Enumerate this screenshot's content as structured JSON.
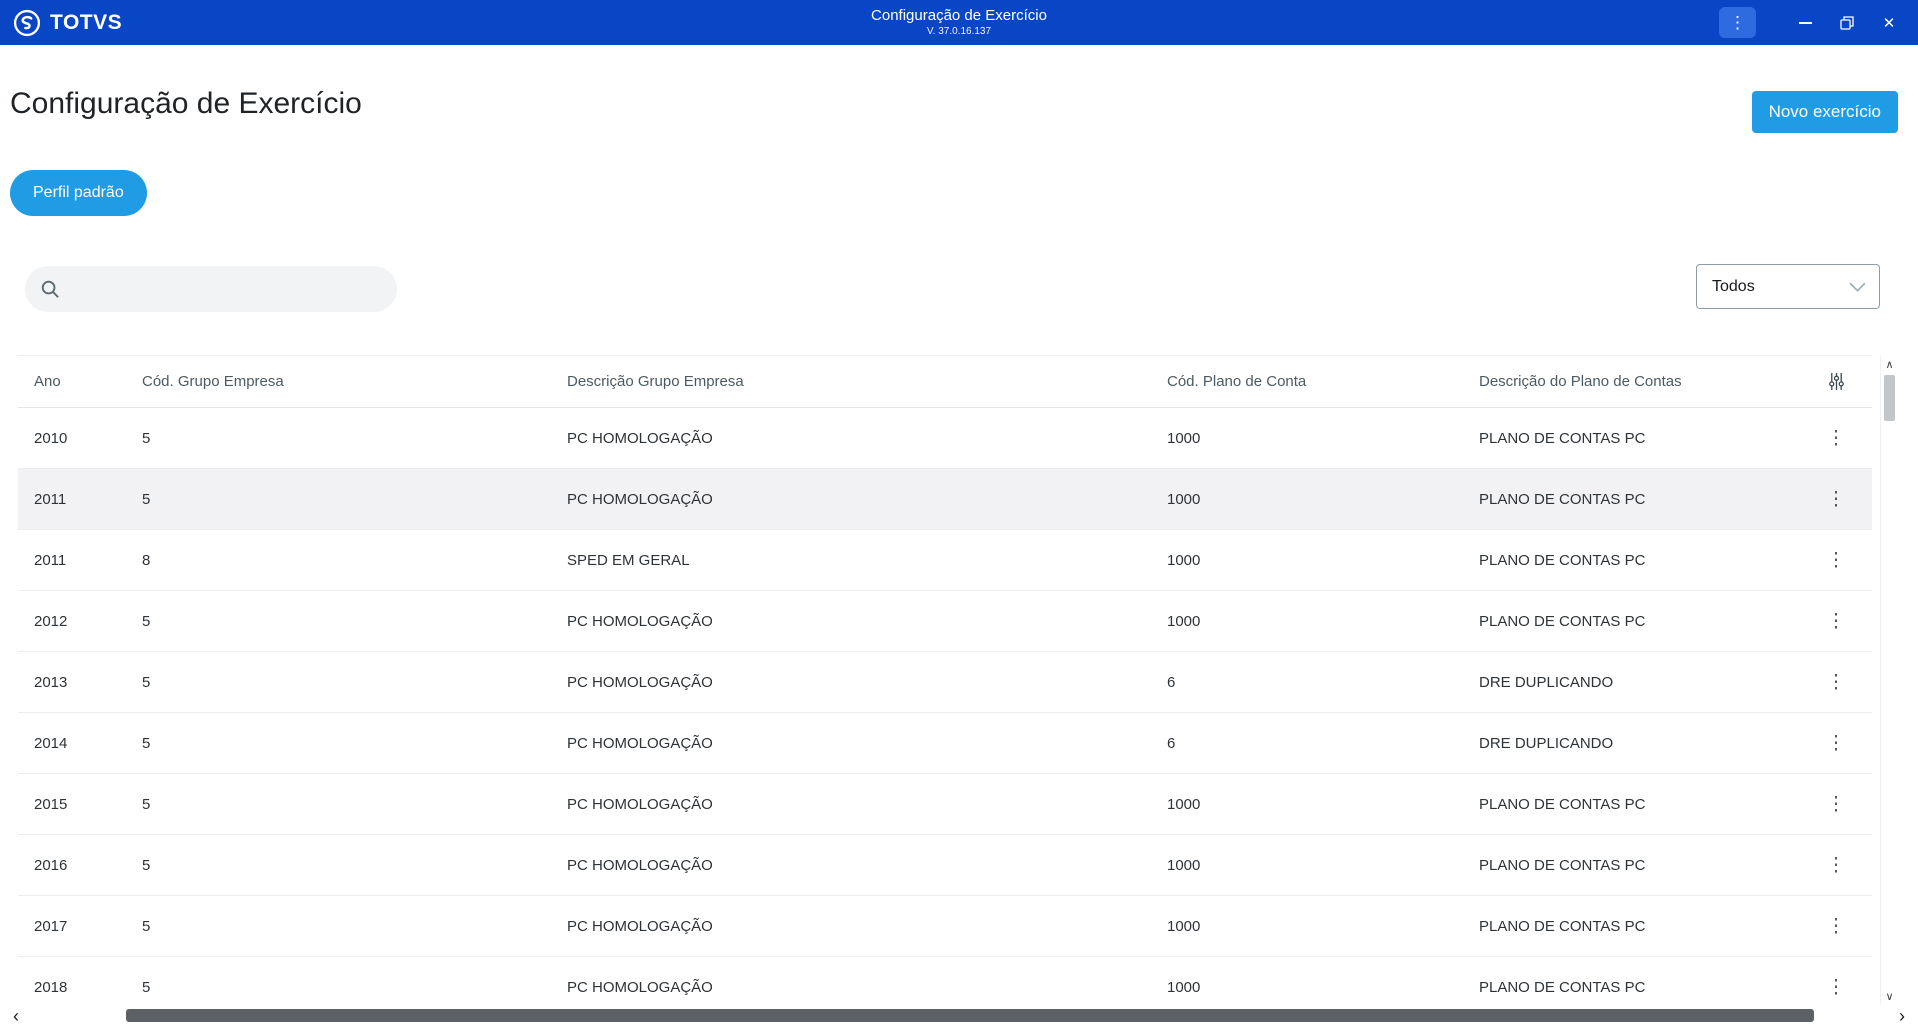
{
  "colors": {
    "titlebar_bg": "#0846C5",
    "accent": "#1F9CE3",
    "accent_dark": "#2F6BE0",
    "selected_row_bg": "#F2F2F4",
    "border": "#E6E8EA",
    "text": "#2E3338",
    "muted": "#4C5B63"
  },
  "titlebar": {
    "brand": "TOTVS",
    "title": "Configuração de Exercício",
    "version": "V. 37.0.16.137",
    "menu_icon": "⋮",
    "close_icon": "✕"
  },
  "page": {
    "title": "Configuração de Exercício",
    "new_exercise_button": "Novo exercício",
    "profile_chip": "Perfil padrão"
  },
  "toolbar": {
    "search_placeholder": "",
    "filter_dropdown_value": "Todos"
  },
  "table": {
    "columns": [
      "Ano",
      "Cód. Grupo Empresa",
      "Descrição Grupo Empresa",
      "Cód. Plano de Conta",
      "Descrição do Plano de Contas"
    ],
    "selected_row_index": 1,
    "row_menu_icon": "⋮",
    "rows": [
      [
        "2010",
        "5",
        "PC HOMOLOGAÇÃO",
        "1000",
        "PLANO DE CONTAS PC"
      ],
      [
        "2011",
        "5",
        "PC HOMOLOGAÇÃO",
        "1000",
        "PLANO DE CONTAS PC"
      ],
      [
        "2011",
        "8",
        "SPED EM GERAL",
        "1000",
        "PLANO DE CONTAS PC"
      ],
      [
        "2012",
        "5",
        "PC HOMOLOGAÇÃO",
        "1000",
        "PLANO DE CONTAS PC"
      ],
      [
        "2013",
        "5",
        "PC HOMOLOGAÇÃO",
        "6",
        "DRE DUPLICANDO"
      ],
      [
        "2014",
        "5",
        "PC HOMOLOGAÇÃO",
        "6",
        "DRE DUPLICANDO"
      ],
      [
        "2015",
        "5",
        "PC HOMOLOGAÇÃO",
        "1000",
        "PLANO DE CONTAS PC"
      ],
      [
        "2016",
        "5",
        "PC HOMOLOGAÇÃO",
        "1000",
        "PLANO DE CONTAS PC"
      ],
      [
        "2017",
        "5",
        "PC HOMOLOGAÇÃO",
        "1000",
        "PLANO DE CONTAS PC"
      ],
      [
        "2018",
        "5",
        "PC HOMOLOGAÇÃO",
        "1000",
        "PLANO DE CONTAS PC"
      ]
    ]
  },
  "scrollbars": {
    "up": "∧",
    "down": "∨",
    "left": "‹",
    "right": "›"
  }
}
